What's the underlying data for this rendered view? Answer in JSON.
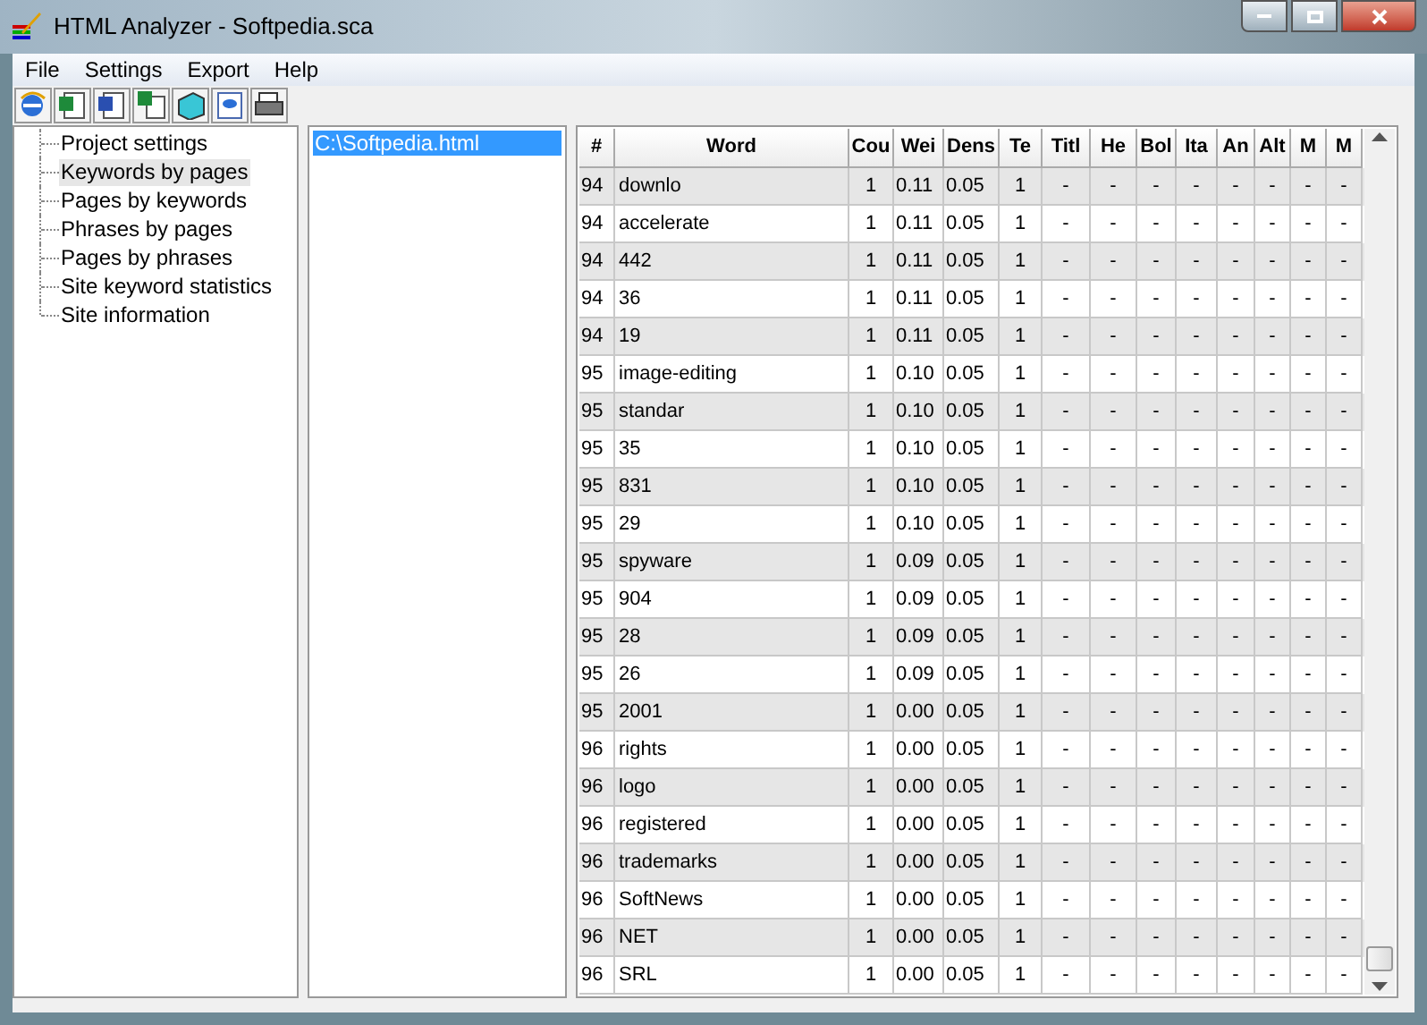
{
  "window": {
    "title": "HTML Analyzer - Softpedia.sca"
  },
  "menu": [
    "File",
    "Settings",
    "Export",
    "Help"
  ],
  "toolbar": [
    {
      "kind": "browser"
    },
    {
      "kind": "excel"
    },
    {
      "kind": "word"
    },
    {
      "kind": "sheet"
    },
    {
      "kind": "book"
    },
    {
      "kind": "html"
    },
    {
      "kind": "print"
    }
  ],
  "tree": {
    "items": [
      {
        "label": "Project settings",
        "selected": false
      },
      {
        "label": "Keywords by pages",
        "selected": true
      },
      {
        "label": "Pages by keywords",
        "selected": false
      },
      {
        "label": "Phrases  by pages",
        "selected": false
      },
      {
        "label": "Pages by phrases",
        "selected": false
      },
      {
        "label": "Site keyword statistics",
        "selected": false
      },
      {
        "label": "Site information",
        "selected": false
      }
    ]
  },
  "pages": {
    "items": [
      {
        "label": "C:\\Softpedia.html",
        "selected": true
      }
    ]
  },
  "table": {
    "columns": [
      "#",
      "Word",
      "Cou",
      "Wei",
      "Dens",
      "Te",
      "Titl",
      "He",
      "Bol",
      "Ita",
      "An",
      "Alt",
      "M",
      "M"
    ],
    "rows": [
      [
        "94",
        "downlo",
        "1",
        "0.11",
        "0.05",
        "1",
        "-",
        "-",
        "-",
        "-",
        "-",
        "-",
        "-",
        "-"
      ],
      [
        "94",
        "accelerate",
        "1",
        "0.11",
        "0.05",
        "1",
        "-",
        "-",
        "-",
        "-",
        "-",
        "-",
        "-",
        "-"
      ],
      [
        "94",
        "442",
        "1",
        "0.11",
        "0.05",
        "1",
        "-",
        "-",
        "-",
        "-",
        "-",
        "-",
        "-",
        "-"
      ],
      [
        "94",
        "36",
        "1",
        "0.11",
        "0.05",
        "1",
        "-",
        "-",
        "-",
        "-",
        "-",
        "-",
        "-",
        "-"
      ],
      [
        "94",
        "19",
        "1",
        "0.11",
        "0.05",
        "1",
        "-",
        "-",
        "-",
        "-",
        "-",
        "-",
        "-",
        "-"
      ],
      [
        "95",
        "image-editing",
        "1",
        "0.10",
        "0.05",
        "1",
        "-",
        "-",
        "-",
        "-",
        "-",
        "-",
        "-",
        "-"
      ],
      [
        "95",
        "standar",
        "1",
        "0.10",
        "0.05",
        "1",
        "-",
        "-",
        "-",
        "-",
        "-",
        "-",
        "-",
        "-"
      ],
      [
        "95",
        "35",
        "1",
        "0.10",
        "0.05",
        "1",
        "-",
        "-",
        "-",
        "-",
        "-",
        "-",
        "-",
        "-"
      ],
      [
        "95",
        "831",
        "1",
        "0.10",
        "0.05",
        "1",
        "-",
        "-",
        "-",
        "-",
        "-",
        "-",
        "-",
        "-"
      ],
      [
        "95",
        "29",
        "1",
        "0.10",
        "0.05",
        "1",
        "-",
        "-",
        "-",
        "-",
        "-",
        "-",
        "-",
        "-"
      ],
      [
        "95",
        "spyware",
        "1",
        "0.09",
        "0.05",
        "1",
        "-",
        "-",
        "-",
        "-",
        "-",
        "-",
        "-",
        "-"
      ],
      [
        "95",
        "904",
        "1",
        "0.09",
        "0.05",
        "1",
        "-",
        "-",
        "-",
        "-",
        "-",
        "-",
        "-",
        "-"
      ],
      [
        "95",
        "28",
        "1",
        "0.09",
        "0.05",
        "1",
        "-",
        "-",
        "-",
        "-",
        "-",
        "-",
        "-",
        "-"
      ],
      [
        "95",
        "26",
        "1",
        "0.09",
        "0.05",
        "1",
        "-",
        "-",
        "-",
        "-",
        "-",
        "-",
        "-",
        "-"
      ],
      [
        "95",
        "2001",
        "1",
        "0.00",
        "0.05",
        "1",
        "-",
        "-",
        "-",
        "-",
        "-",
        "-",
        "-",
        "-"
      ],
      [
        "96",
        "rights",
        "1",
        "0.00",
        "0.05",
        "1",
        "-",
        "-",
        "-",
        "-",
        "-",
        "-",
        "-",
        "-"
      ],
      [
        "96",
        "logo",
        "1",
        "0.00",
        "0.05",
        "1",
        "-",
        "-",
        "-",
        "-",
        "-",
        "-",
        "-",
        "-"
      ],
      [
        "96",
        "registered",
        "1",
        "0.00",
        "0.05",
        "1",
        "-",
        "-",
        "-",
        "-",
        "-",
        "-",
        "-",
        "-"
      ],
      [
        "96",
        "trademarks",
        "1",
        "0.00",
        "0.05",
        "1",
        "-",
        "-",
        "-",
        "-",
        "-",
        "-",
        "-",
        "-"
      ],
      [
        "96",
        "SoftNews",
        "1",
        "0.00",
        "0.05",
        "1",
        "-",
        "-",
        "-",
        "-",
        "-",
        "-",
        "-",
        "-"
      ],
      [
        "96",
        "NET",
        "1",
        "0.00",
        "0.05",
        "1",
        "-",
        "-",
        "-",
        "-",
        "-",
        "-",
        "-",
        "-"
      ],
      [
        "96",
        "SRL",
        "1",
        "0.00",
        "0.05",
        "1",
        "-",
        "-",
        "-",
        "-",
        "-",
        "-",
        "-",
        "-"
      ]
    ]
  }
}
